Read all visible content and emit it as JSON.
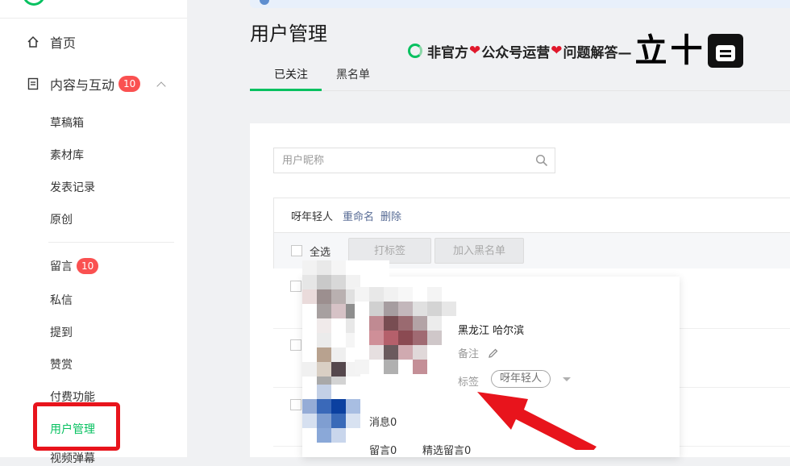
{
  "sidebar": {
    "home": "首页",
    "content": {
      "label": "内容与互动",
      "badge": "10"
    },
    "sub_items": [
      "草稿箱",
      "素材库",
      "发表记录",
      "原创"
    ],
    "comments": {
      "label": "留言",
      "badge": "10"
    },
    "items2": [
      "私信",
      "提到",
      "赞赏",
      "付费功能"
    ],
    "user_mgmt": "用户管理",
    "cut_off": "视频弹幕"
  },
  "header": {
    "title": "用户管理",
    "watermark": {
      "part1": "非官方",
      "part2": "公众号运营",
      "part3": "问题解答—",
      "big1": "立",
      "big2": "十"
    }
  },
  "tabs": [
    "已关注",
    "黑名单"
  ],
  "search": {
    "placeholder": "用户昵称"
  },
  "group": {
    "name": "呀年轻人",
    "rename": "重命名",
    "delete": "删除"
  },
  "toolbar": {
    "select_all": "全选",
    "tag_btn": "打标签",
    "blacklist_btn": "加入黑名单"
  },
  "popup": {
    "location": "黑龙江 哈尔滨",
    "note_label": "备注",
    "tag_label": "标签",
    "tag_value": "呀年轻人",
    "messages": "消息0",
    "comments": "留言0",
    "featured_comments": "精选留言0"
  },
  "icons": {
    "home": "home-icon",
    "content": "document-icon",
    "search": "search-icon",
    "edit": "pencil-icon"
  },
  "colors": {
    "accent": "#07c160",
    "badge": "#fa5151",
    "link": "#576b95",
    "annotation": "#e8141c"
  }
}
